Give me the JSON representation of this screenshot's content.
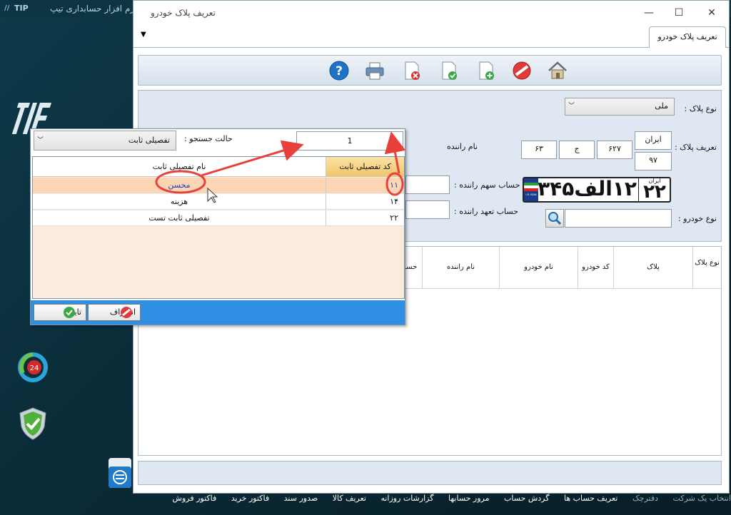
{
  "desktop": {
    "app_icon_text": "TIP",
    "app_name": "نرم افزار حسابداری تیپ",
    "taskbar": [
      "انتخاب یک شرکت",
      "دفترچک",
      "تعریف حساب ها",
      "گردش حساب",
      "مرور حسابها",
      "گزارشات روزانه",
      "تعریف کالا",
      "صدور سند",
      "فاکتور خرید",
      "فاکتور فروش"
    ]
  },
  "window": {
    "title": "تعریف پلاک خودرو",
    "tab_label": "تعریف پلاک خودرو",
    "controls": {
      "minimize": "—",
      "maximize": "☐",
      "close": "✕"
    }
  },
  "toolbar": {
    "icons": [
      "help-icon",
      "print-icon",
      "delete-doc-icon",
      "confirm-doc-icon",
      "new-doc-icon",
      "cancel-icon",
      "home-icon"
    ]
  },
  "form": {
    "plate_type_label": "نوع پلاک :",
    "plate_type_value": "ملی",
    "plate_def_label": "تعریف پلاک :",
    "plate_country": "ایران",
    "plate_region": "۹۷",
    "plate_part1": "۶۲۷",
    "plate_letter": "ج",
    "plate_part2": "۶۳",
    "plate_image_text": "۱۲الف۳۴۵",
    "plate_image_region": "۲۲",
    "plate_image_top": "ایران",
    "plate_image_country_code": "I.R. IRAN",
    "driver_name_label": "نام راننده",
    "driver_share_label": "حساب سهم راننده :",
    "driver_commit_label": "حساب تعهد راننده :",
    "vehicle_type_label": "نوع خودرو :"
  },
  "grid": {
    "columns": [
      "نوع پلاک",
      "پلاک",
      "کد خودرو",
      "نام خودرو",
      "نام راننده",
      "حساب"
    ]
  },
  "popup": {
    "search_mode_label": "حالت جستجو :",
    "search_mode_value": "تفصیلی ثابت",
    "search_value": "1",
    "col_code": "کد تفصیلی ثابت",
    "col_name": "نام تفصیلی ثابت",
    "rows": [
      {
        "code": "۱۱",
        "name": "محسن"
      },
      {
        "code": "۱۴",
        "name": "هزینه"
      },
      {
        "code": "۲۲",
        "name": "تفصیلی ثابت تست"
      }
    ],
    "confirm_label": "تایید",
    "cancel_label": "انصراف"
  },
  "colors": {
    "accent": "#2f8fe2",
    "selected_row": "#fcd5b5",
    "annotation": "#e8413c"
  }
}
